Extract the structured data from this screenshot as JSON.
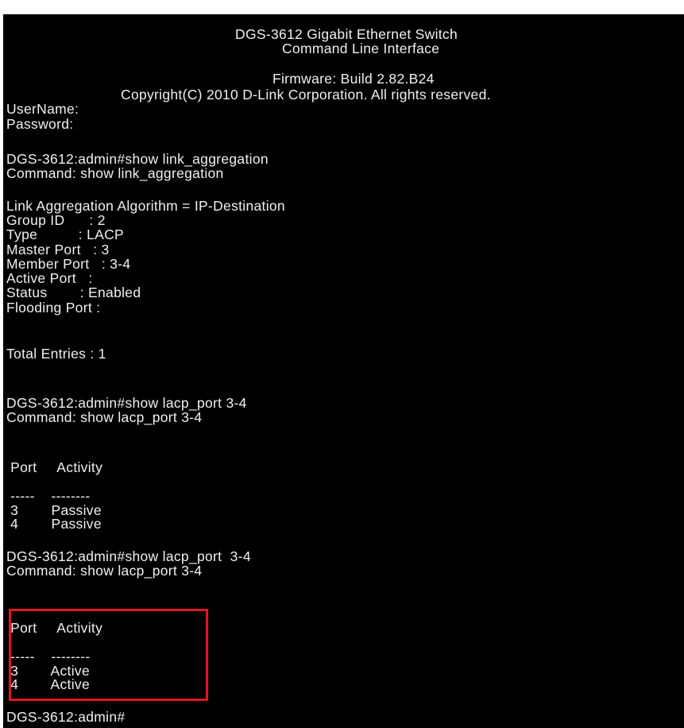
{
  "header": {
    "title": "DGS-3612 Gigabit Ethernet Switch",
    "subtitle": "Command Line Interface",
    "firmware": "Firmware: Build 2.82.B24",
    "copyright": "Copyright(C) 2010 D-Link Corporation. All rights reserved."
  },
  "login": {
    "username_prompt": "UserName:",
    "password_prompt": "Password:"
  },
  "session1": {
    "prompt_line": "DGS-3612:admin#show link_aggregation",
    "command_echo": "Command: show link_aggregation",
    "algorithm": "Link Aggregation Algorithm = IP-Destination",
    "fields": [
      "Group ID      : 2",
      "Type          : LACP",
      "Master Port   : 3",
      "Member Port   : 3-4",
      "Active Port   :",
      "Status        : Enabled",
      "Flooding Port :"
    ],
    "total": "Total Entries : 1"
  },
  "session2": {
    "prompt_line": "DGS-3612:admin#show lacp_port 3-4",
    "command_echo": "Command: show lacp_port 3-4",
    "table_header": " Port     Activity",
    "separator": " -----    --------",
    "rows": [
      " 3        Passive",
      " 4        Passive"
    ]
  },
  "session3": {
    "prompt_line": "DGS-3612:admin#show lacp_port  3-4",
    "command_echo": "Command: show lacp_port 3-4",
    "table_header": " Port     Activity",
    "separator": " -----    --------",
    "rows": [
      " 3        Active",
      " 4        Active"
    ]
  },
  "final_prompt": "DGS-3612:admin#",
  "colors": {
    "background": "#000000",
    "text": "#f0f0f0",
    "highlight": "#e0171d"
  }
}
